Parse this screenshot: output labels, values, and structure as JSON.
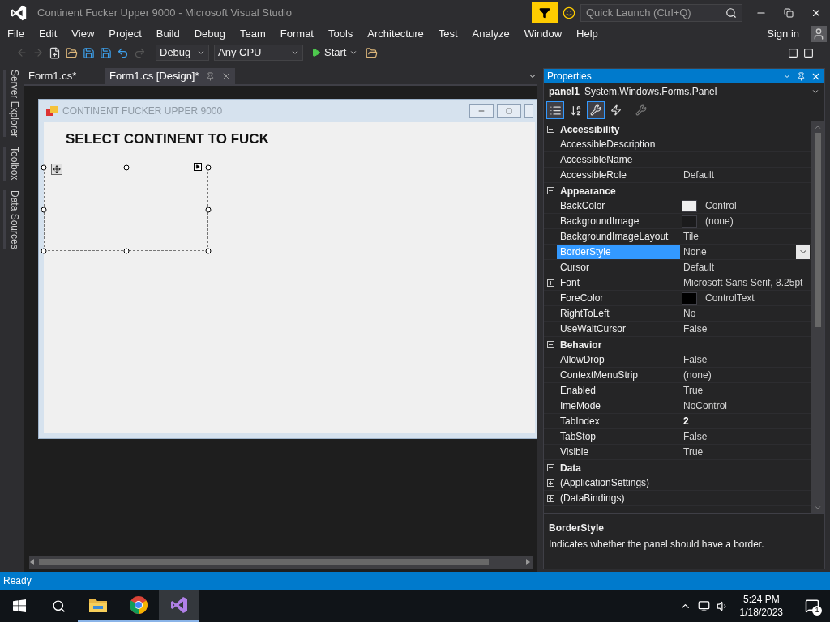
{
  "window": {
    "title": "Continent Fucker Upper 9000 - Microsoft Visual Studio"
  },
  "quick_launch": {
    "placeholder": "Quick Launch (Ctrl+Q)"
  },
  "menu": [
    "File",
    "Edit",
    "View",
    "Project",
    "Build",
    "Debug",
    "Team",
    "Format",
    "Tools",
    "Architecture",
    "Test",
    "Analyze",
    "Window",
    "Help"
  ],
  "sign_in": "Sign in",
  "toolbar": {
    "configuration": "Debug",
    "platform": "Any CPU",
    "start": "Start"
  },
  "side_tabs": [
    "Server Explorer",
    "Toolbox",
    "Data Sources"
  ],
  "doc_tabs": [
    {
      "label": "Form1.cs*",
      "selected": false
    },
    {
      "label": "Form1.cs [Design]*",
      "selected": true
    }
  ],
  "form": {
    "title": "CONTINENT FUCKER UPPER 9000",
    "heading": "SELECT CONTINENT TO FUCK"
  },
  "properties": {
    "title": "Properties",
    "object_name": "panel1",
    "object_type": "System.Windows.Forms.Panel",
    "view_buttons": [
      {
        "kind": "categorized",
        "selected": true
      },
      {
        "kind": "alphabetical",
        "selected": false
      },
      {
        "kind": "properties",
        "selected": true
      },
      {
        "kind": "events",
        "selected": false
      },
      {
        "kind": "pages",
        "selected": false
      }
    ],
    "categories": [
      {
        "name": "Accessibility",
        "expanded": true,
        "items": [
          {
            "name": "AccessibleDescription",
            "selected": false,
            "expandable": false
          },
          {
            "name": "AccessibleName",
            "selected": false,
            "expandable": false
          },
          {
            "name": "AccessibleRole",
            "value": "Default",
            "selected": false,
            "modified": false,
            "expandable": false
          }
        ]
      },
      {
        "name": "Appearance",
        "expanded": true,
        "items": [
          {
            "name": "BackColor",
            "value": "Control",
            "color": "#f0f0f0",
            "selected": false,
            "modified": false,
            "expandable": false
          },
          {
            "name": "BackgroundImage",
            "value": "(none)",
            "color": "#1b1b1c",
            "selected": false,
            "modified": false,
            "expandable": false
          },
          {
            "name": "BackgroundImageLayout",
            "value": "Tile",
            "selected": false,
            "modified": false,
            "expandable": false
          },
          {
            "name": "BorderStyle",
            "value": "None",
            "selected": true,
            "modified": false,
            "expandable": false
          },
          {
            "name": "Cursor",
            "value": "Default",
            "selected": false,
            "modified": false,
            "expandable": false
          },
          {
            "name": "Font",
            "value": "Microsoft Sans Serif, 8.25pt",
            "selected": false,
            "modified": false,
            "expandable": true
          },
          {
            "name": "ForeColor",
            "value": "ControlText",
            "color": "#000000",
            "selected": false,
            "modified": false,
            "expandable": false
          },
          {
            "name": "RightToLeft",
            "value": "No",
            "selected": false,
            "modified": false,
            "expandable": false
          },
          {
            "name": "UseWaitCursor",
            "value": "False",
            "selected": false,
            "modified": false,
            "expandable": false
          }
        ]
      },
      {
        "name": "Behavior",
        "expanded": true,
        "items": [
          {
            "name": "AllowDrop",
            "value": "False",
            "selected": false,
            "modified": false,
            "expandable": false
          },
          {
            "name": "ContextMenuStrip",
            "value": "(none)",
            "selected": false,
            "modified": false,
            "expandable": false
          },
          {
            "name": "Enabled",
            "value": "True",
            "selected": false,
            "modified": false,
            "expandable": false
          },
          {
            "name": "ImeMode",
            "value": "NoControl",
            "selected": false,
            "modified": false,
            "expandable": false
          },
          {
            "name": "TabIndex",
            "value": "2",
            "selected": false,
            "modified": true,
            "expandable": false
          },
          {
            "name": "TabStop",
            "value": "False",
            "selected": false,
            "modified": false,
            "expandable": false
          },
          {
            "name": "Visible",
            "value": "True",
            "selected": false,
            "modified": false,
            "expandable": false
          }
        ]
      },
      {
        "name": "Data",
        "expanded": true,
        "items": [
          {
            "name": "(ApplicationSettings)",
            "selected": false,
            "expandable": true
          },
          {
            "name": "(DataBindings)",
            "selected": false,
            "expandable": true
          }
        ]
      }
    ],
    "description": {
      "title": "BorderStyle",
      "text": "Indicates whether the panel should have a border."
    }
  },
  "status_bar": {
    "text": "Ready"
  },
  "taskbar": {
    "apps": [
      {
        "kind": "explorer",
        "selected": false
      },
      {
        "kind": "chrome",
        "selected": false
      },
      {
        "kind": "studio",
        "selected": true
      }
    ],
    "time": "5:24 PM",
    "date": "1/18/2023",
    "notifications": "1"
  }
}
